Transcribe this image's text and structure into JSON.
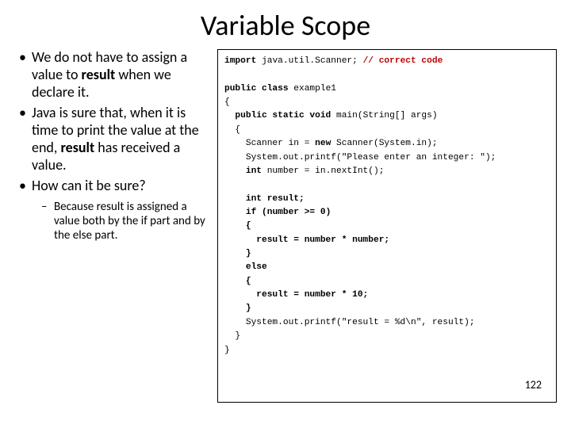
{
  "title": "Variable Scope",
  "bullets": [
    {
      "pre": "We do not have to assign a value to ",
      "bold": "result",
      "post": " when we declare it."
    },
    {
      "pre": "Java is sure that, when it is time to print the value at the end, ",
      "bold": "result",
      "post": " has received a value."
    },
    {
      "pre": "How can it be sure?",
      "bold": "",
      "post": ""
    }
  ],
  "subbullet": "Because result is assigned a value both by the if part and by the else part.",
  "code": {
    "l1a": "import",
    "l1b": " java.util.Scanner; ",
    "l1c": "// correct code",
    "l2a": "public class",
    "l2b": " example1",
    "l3": "{",
    "l4a": "  public static void",
    "l4b": " main(String[] args)",
    "l5": "  {",
    "l6a": "    Scanner in = ",
    "l6b": "new",
    "l6c": " Scanner(System.in);",
    "l7": "    System.out.printf(\"Please enter an integer: \");",
    "l8a": "    int",
    "l8b": " number = in.nextInt();",
    "l9a": "    int",
    "l9b": " result;",
    "l10a": "    if",
    "l10b": " (number >= 0)",
    "l11": "    {",
    "l12": "      result = number * number;",
    "l13": "    }",
    "l14": "    else",
    "l15": "    {",
    "l16": "      result = number * 10;",
    "l17": "    }",
    "l18": "    System.out.printf(\"result = %d\\n\", result);",
    "l19": "  }",
    "l20": "}"
  },
  "pagenum": "122"
}
